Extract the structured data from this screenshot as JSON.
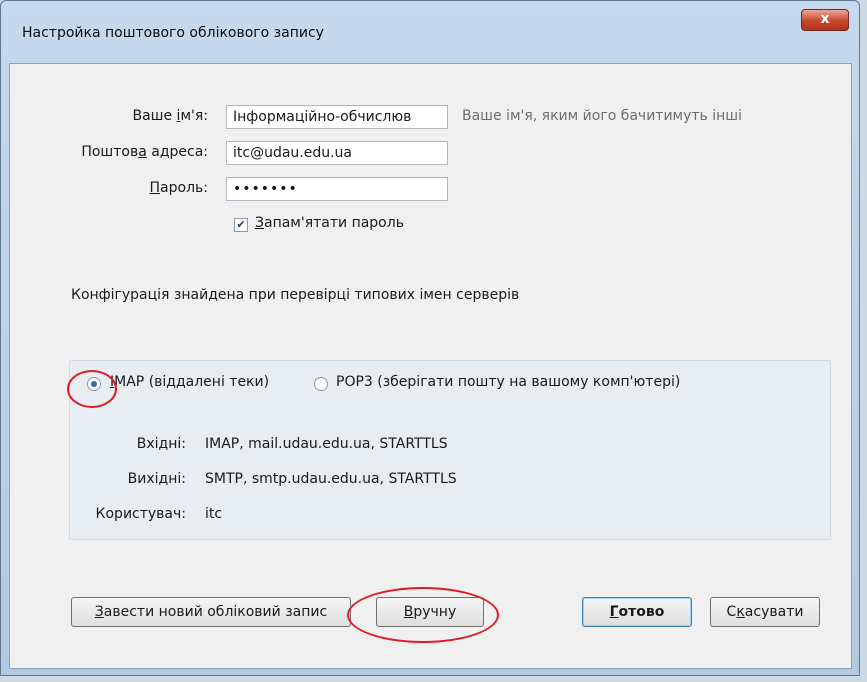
{
  "window": {
    "title": "Настройка поштового облікового запису",
    "close_label": "x"
  },
  "form": {
    "name_label_pre": "Ваше ",
    "name_label_u": "і",
    "name_label_post": "м'я:",
    "name_value": "Інформаційно-обчислюв",
    "name_hint": "Ваше ім'я, яким його бачитимуть інші",
    "email_label_pre": "Поштов",
    "email_label_u": "а",
    "email_label_post": " адреса:",
    "email_value": "itc@udau.edu.ua",
    "password_label_u": "П",
    "password_label_post": "ароль:",
    "password_value": "•••••••",
    "remember_checked": "✔",
    "remember_label_u": "З",
    "remember_label_post": "апам'ятати пароль"
  },
  "status": {
    "message": "Конфігурація знайдена при перевірці типових імен серверів"
  },
  "protocol": {
    "imap_label_u": "I",
    "imap_label_post": "MAP (віддалені теки)",
    "pop3_label": "POP3 (зберігати пошту на вашому комп'ютері)",
    "selected": "imap"
  },
  "servers": {
    "incoming_label": "Вхідні:",
    "incoming_value": "IMAP, mail.udau.edu.ua, STARTTLS",
    "outgoing_label": "Вихідні:",
    "outgoing_value": "SMTP, smtp.udau.edu.ua, STARTTLS",
    "user_label": "Користувач:",
    "user_value": "itc"
  },
  "buttons": {
    "new_account_u": "З",
    "new_account_post": "авести новий обліковий запис",
    "manual_u": "В",
    "manual_post": "ручну",
    "done_u": "Г",
    "done_post": "отово",
    "cancel_pre": "С",
    "cancel_u": "к",
    "cancel_post": "асувати"
  },
  "colors": {
    "annotation": "#e01b24",
    "accent": "#2a68b8"
  }
}
